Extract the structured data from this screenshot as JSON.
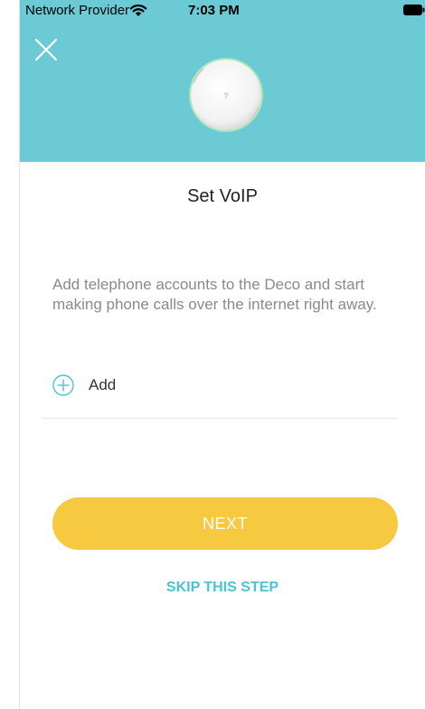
{
  "status_bar": {
    "provider": "Network Provider",
    "time": "7:03 PM"
  },
  "page": {
    "title": "Set VoIP",
    "description": "Add telephone accounts to the Deco and start making phone calls over the internet right away."
  },
  "add_row": {
    "label": "Add"
  },
  "buttons": {
    "next": "NEXT",
    "skip": "SKIP THIS STEP"
  },
  "colors": {
    "header_bg": "#6ccad4",
    "primary_button": "#f7c941",
    "link": "#4cc3cf"
  }
}
